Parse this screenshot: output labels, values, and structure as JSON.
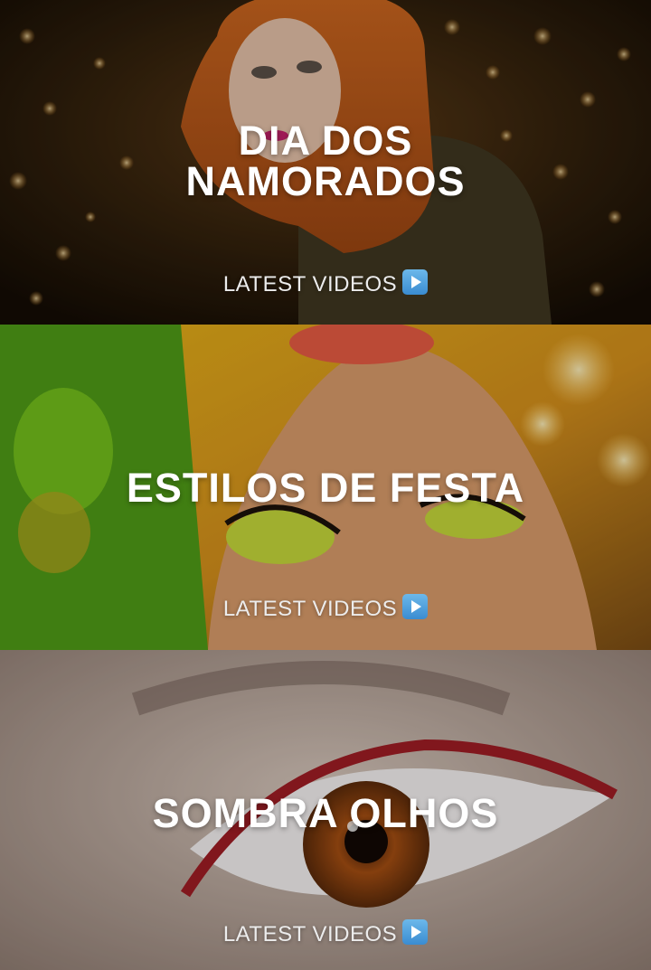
{
  "banners": [
    {
      "title": "DIA DOS NAMORADOS",
      "cta": "LATEST VIDEOS",
      "cta_icon": "play-button-icon"
    },
    {
      "title": "ESTILOS DE FESTA",
      "cta": "LATEST VIDEOS",
      "cta_icon": "play-button-icon"
    },
    {
      "title": "SOMBRA OLHOS",
      "cta": "LATEST VIDEOS",
      "cta_icon": "play-button-icon"
    }
  ],
  "colors": {
    "title": "#ffffff",
    "cta_text": "#ececec",
    "play_icon": "#4aa3e0"
  }
}
